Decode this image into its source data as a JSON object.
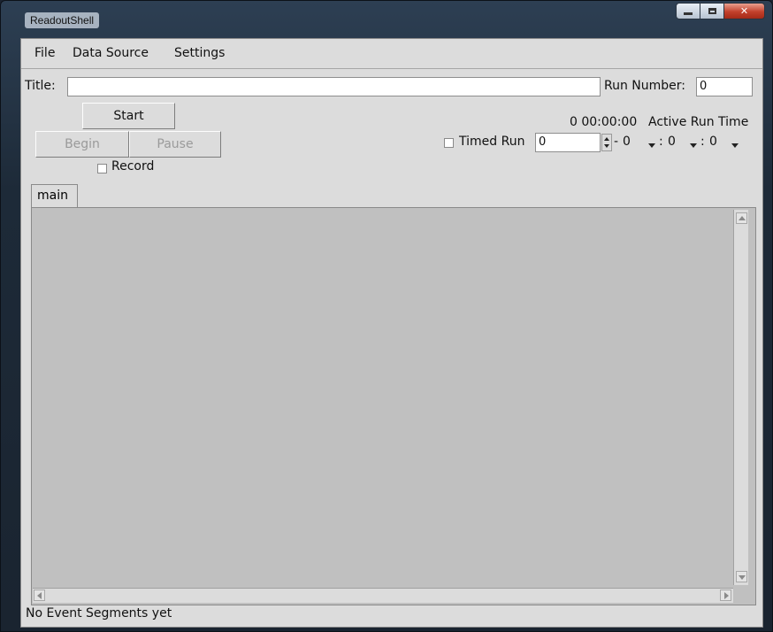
{
  "window": {
    "title": "ReadoutShell",
    "close_glyph": "✕"
  },
  "menu": [
    "File",
    "Data Source",
    "Settings"
  ],
  "controls": {
    "title_label": "Title:",
    "title_value": "",
    "run_number_label": "Run Number:",
    "run_number_value": "0",
    "start_label": "Start",
    "begin_label": "Begin",
    "pause_label": "Pause",
    "record_label": "Record",
    "record_checked": false,
    "elapsed_time": "0 00:00:00",
    "active_run_time_label": "Active Run Time",
    "timed_run_label": "Timed Run",
    "timed_run_checked": false,
    "days_value": "0",
    "hours_value": "0",
    "minutes_value": "0",
    "seconds_value": "0",
    "sep_dash": "-",
    "sep_colon": ":"
  },
  "tabs": [
    "main"
  ],
  "status": "No Event Segments yet",
  "icons": [
    "minimize-icon",
    "maximize-icon",
    "close-icon",
    "spin-up-icon",
    "spin-down-icon",
    "dropdown-arrow-icon",
    "scroll-up-icon",
    "scroll-down-icon",
    "scroll-left-icon",
    "scroll-right-icon"
  ]
}
